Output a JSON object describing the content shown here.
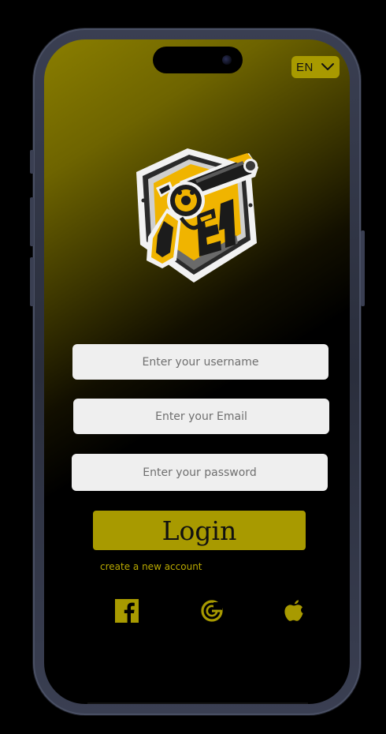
{
  "language": {
    "selected": "EN"
  },
  "form": {
    "username_placeholder": "Enter your username",
    "email_placeholder": "Enter your Email",
    "password_placeholder": "Enter your password",
    "login_label": "Login",
    "create_account_label": "create a new account"
  },
  "social": [
    "facebook-icon",
    "google-icon",
    "apple-icon"
  ],
  "colors": {
    "accent": "#a89a00",
    "link": "#b8a800",
    "field_bg": "#efefef",
    "background": "#000000"
  }
}
